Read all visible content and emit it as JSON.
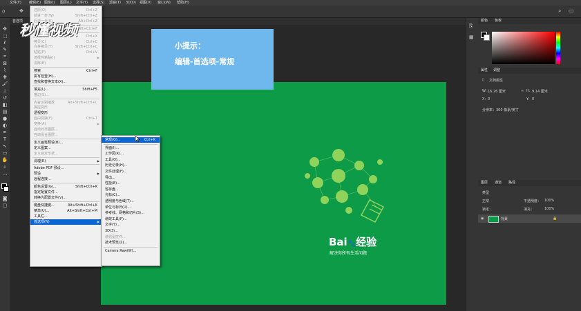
{
  "menubar": {
    "items": [
      "文件(F)",
      "编辑(E)",
      "图像(I)",
      "图层(L)",
      "文字(Y)",
      "选择(S)",
      "滤镜(T)",
      "3D(D)",
      "视图(V)",
      "窗口(W)",
      "帮助(H)"
    ]
  },
  "document": {
    "tab_label": "首选项"
  },
  "watermark": {
    "logo_text": "秒懂视频"
  },
  "tip": {
    "line1": "小提示：",
    "line2": "编辑-首选项-常规"
  },
  "baidu": {
    "brand": "Bai",
    "paw": "du",
    "product": "经验",
    "slogan": "解决你所有生活问题"
  },
  "edit_menu": {
    "items": [
      {
        "label": "还原(O)",
        "shortcut": "Ctrl+Z",
        "disabled": true
      },
      {
        "label": "前进一步(W)",
        "shortcut": "Shift+Ctrl+Z",
        "disabled": true
      },
      {
        "label": "后退一步(K)",
        "shortcut": "Alt+Ctrl+Z",
        "disabled": true
      },
      {
        "sep": true
      },
      {
        "label": "渐隐(D)...",
        "shortcut": "Shift+Ctrl+F",
        "disabled": true
      },
      {
        "sep": true
      },
      {
        "label": "剪切(T)",
        "shortcut": "Ctrl+X",
        "disabled": true
      },
      {
        "label": "拷贝(C)",
        "shortcut": "Ctrl+C",
        "disabled": true
      },
      {
        "label": "合并拷贝(Y)",
        "shortcut": "Shift+Ctrl+C",
        "disabled": true
      },
      {
        "label": "粘贴(P)",
        "shortcut": "Ctrl+V",
        "disabled": true
      },
      {
        "label": "选择性粘贴(I)",
        "shortcut": "",
        "disabled": true,
        "arrow": true
      },
      {
        "label": "清除(E)",
        "shortcut": "",
        "disabled": true
      },
      {
        "sep": true
      },
      {
        "label": "搜索",
        "shortcut": "Ctrl+F"
      },
      {
        "label": "拼写检查(H)...",
        "shortcut": ""
      },
      {
        "label": "查找和替换文本(X)...",
        "shortcut": ""
      },
      {
        "sep": true
      },
      {
        "label": "填充(L)...",
        "shortcut": "Shift+F5"
      },
      {
        "label": "描边(S)...",
        "shortcut": "",
        "disabled": true
      },
      {
        "sep": true
      },
      {
        "label": "内容识别缩放",
        "shortcut": "Alt+Shift+Ctrl+C",
        "disabled": true
      },
      {
        "label": "操控变形",
        "shortcut": "",
        "disabled": true
      },
      {
        "label": "透视变形",
        "shortcut": ""
      },
      {
        "label": "自由变换(F)",
        "shortcut": "Ctrl+T",
        "disabled": true
      },
      {
        "label": "变换(A)",
        "shortcut": "",
        "disabled": true,
        "arrow": true
      },
      {
        "label": "自动对齐图层...",
        "shortcut": "",
        "disabled": true
      },
      {
        "label": "自动混合图层...",
        "shortcut": "",
        "disabled": true
      },
      {
        "sep": true
      },
      {
        "label": "定义画笔预设(B)...",
        "shortcut": ""
      },
      {
        "label": "定义图案...",
        "shortcut": ""
      },
      {
        "label": "定义自定形状...",
        "shortcut": "",
        "disabled": true
      },
      {
        "sep": true
      },
      {
        "label": "清理(R)",
        "shortcut": "",
        "arrow": true
      },
      {
        "sep": true
      },
      {
        "label": "Adobe PDF 预设...",
        "shortcut": ""
      },
      {
        "label": "预设",
        "shortcut": "",
        "arrow": true
      },
      {
        "label": "远程连接...",
        "shortcut": ""
      },
      {
        "sep": true
      },
      {
        "label": "颜色设置(G)...",
        "shortcut": "Shift+Ctrl+K"
      },
      {
        "label": "指定配置文件...",
        "shortcut": ""
      },
      {
        "label": "转换为配置文件(V)...",
        "shortcut": ""
      },
      {
        "sep": true
      },
      {
        "label": "键盘快捷键...",
        "shortcut": "Alt+Shift+Ctrl+K"
      },
      {
        "label": "菜单(U)...",
        "shortcut": "Alt+Shift+Ctrl+M"
      },
      {
        "label": "工具栏...",
        "shortcut": ""
      },
      {
        "label": "首选项(N)",
        "shortcut": "",
        "arrow": true,
        "selected": true
      }
    ]
  },
  "pref_submenu": {
    "items": [
      {
        "label": "常规(G)...",
        "shortcut": "Ctrl+K",
        "selected": true
      },
      {
        "sep": true
      },
      {
        "label": "界面(I)...",
        "shortcut": ""
      },
      {
        "label": "工作区(K)...",
        "shortcut": ""
      },
      {
        "label": "工具(O)...",
        "shortcut": ""
      },
      {
        "label": "历史记录(H)...",
        "shortcut": ""
      },
      {
        "label": "文件处理(F)...",
        "shortcut": ""
      },
      {
        "label": "导出...",
        "shortcut": ""
      },
      {
        "label": "性能(E)...",
        "shortcut": ""
      },
      {
        "label": "暂存盘...",
        "shortcut": ""
      },
      {
        "label": "光标(C)...",
        "shortcut": ""
      },
      {
        "label": "透明度与色域(T)...",
        "shortcut": ""
      },
      {
        "label": "单位与标尺(U)...",
        "shortcut": ""
      },
      {
        "label": "参考线、网格和切片(S)...",
        "shortcut": ""
      },
      {
        "label": "增效工具(P)...",
        "shortcut": ""
      },
      {
        "label": "文字(Y)...",
        "shortcut": ""
      },
      {
        "label": "3D(3)...",
        "shortcut": ""
      },
      {
        "label": "增强型控件...",
        "shortcut": "",
        "disabled": true
      },
      {
        "label": "技术预览(Z)...",
        "shortcut": ""
      },
      {
        "sep": true
      },
      {
        "label": "Camera Raw(W)...",
        "shortcut": ""
      }
    ]
  },
  "right_panels": {
    "color_tabs": [
      "颜色",
      "色板"
    ],
    "props_tabs": [
      "属性",
      "调整"
    ],
    "doc_props_label": "文档属性",
    "w_label": "W:",
    "w_value": "16.26 厘米",
    "h_label": "H:",
    "h_value": "9.14 厘米",
    "x_label": "X:",
    "x_value": "0",
    "y_label": "Y:",
    "y_value": "0",
    "resolution": "分辨率：300 像素/英寸",
    "layer_tabs": [
      "图层",
      "通道",
      "路径"
    ],
    "kind_label": "类型",
    "blend_mode": "正常",
    "opacity_label": "不透明度：",
    "opacity_value": "100%",
    "lock_label": "锁定：",
    "fill_label": "填充：",
    "fill_value": "100%",
    "layer_name": "背景"
  },
  "colors": {
    "doc_green": "#0d9b48",
    "tip_blue": "#6fb8ee",
    "menu_highlight": "#0a64d2"
  }
}
